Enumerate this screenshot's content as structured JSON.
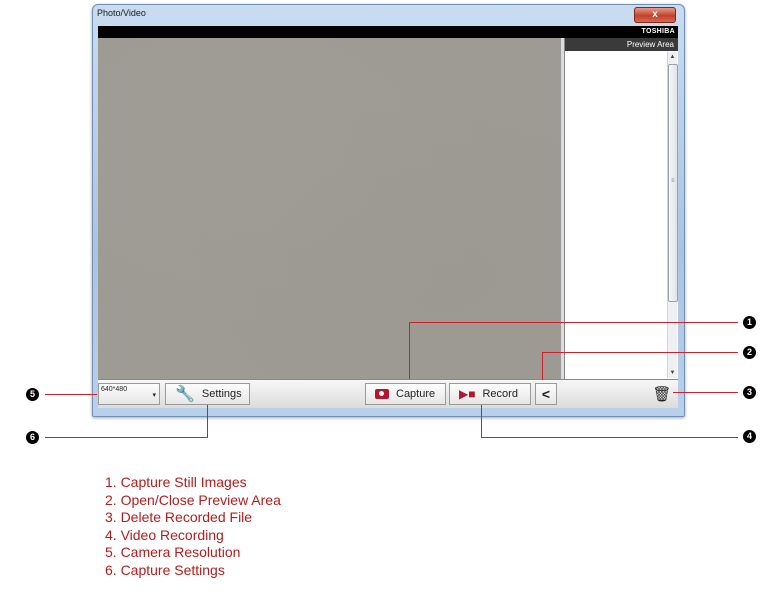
{
  "window": {
    "title": "Photo/Video",
    "close_symbol": "x",
    "brand": "TOSHIBA"
  },
  "preview": {
    "header": "Preview Area"
  },
  "toolbar": {
    "resolution": "640*480",
    "resolution_arrow": "▾",
    "settings_label": "Settings",
    "capture_label": "Capture",
    "record_label": "Record",
    "toggle_symbol": "<",
    "trash_symbol": "🗑"
  },
  "callouts": [
    "1",
    "2",
    "3",
    "4",
    "5",
    "6"
  ],
  "legend": [
    "1. Capture Still Images",
    "2. Open/Close Preview Area",
    "3. Delete Recorded File",
    "4. Video Recording",
    "5. Camera Resolution",
    "6. Capture Settings"
  ],
  "colors": {
    "accent": "#b5162e",
    "callout_line": "#d11f2c",
    "legend_text": "#b51c1c"
  }
}
